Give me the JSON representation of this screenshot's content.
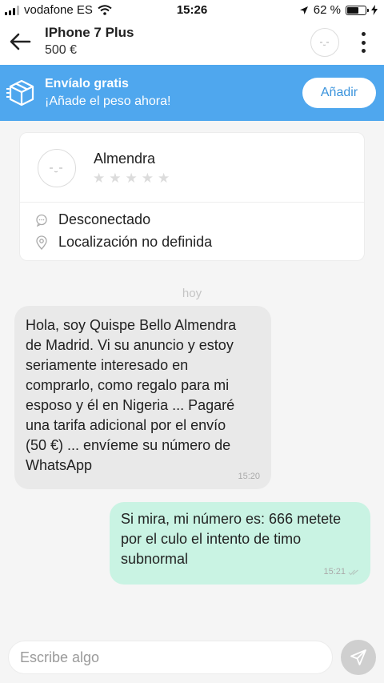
{
  "status_bar": {
    "carrier": "vodafone ES",
    "time": "15:26",
    "battery_percent_label": "62 %",
    "battery_level": 0.62
  },
  "header": {
    "title": "IPhone 7 Plus",
    "price": "500 €",
    "back_icon": "arrow-left-icon",
    "menu_icon": "more-vertical-icon"
  },
  "shipping_banner": {
    "title": "Envíalo gratis",
    "subtitle": "¡Añade el peso ahora!",
    "button_label": "Añadir",
    "background_color": "#4fa7ee",
    "icon": "package-icon"
  },
  "seller": {
    "name": "Almendra",
    "rating_stars": 0,
    "rating_max": 5,
    "status": "Desconectado",
    "location": "Localización no definida"
  },
  "chat": {
    "day_label": "hoy",
    "messages": [
      {
        "direction": "incoming",
        "text": "Hola, soy Quispe Bello Almendra\nde Madrid. Vi su anuncio y estoy\nseriamente interesado en\ncomprarlo, como regalo para mi\nesposo y él en Nigeria ... Pagaré\nuna tarifa adicional por el envío\n(50 €) ... envíeme su número de\nWhatsApp",
        "time": "15:20"
      },
      {
        "direction": "outgoing",
        "text": "Si mira, mi número es: 666 metete\npor el culo el intento de timo\nsubnormal",
        "time": "15:21",
        "read_icon": "double-check-icon"
      }
    ]
  },
  "composer": {
    "placeholder": "Escribe algo",
    "value": "",
    "send_icon": "send-icon"
  },
  "colors": {
    "accent": "#4fa7ee",
    "outgoing_bubble": "#c9f3e3",
    "incoming_bubble": "#e9e9e9"
  }
}
